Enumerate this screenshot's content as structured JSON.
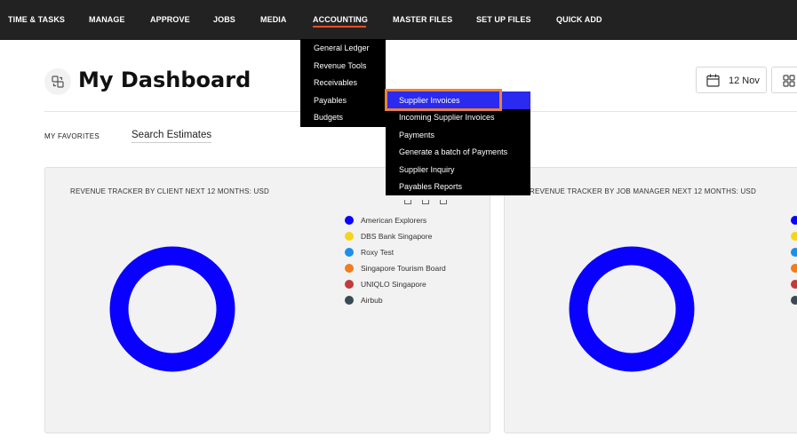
{
  "nav": {
    "items": [
      {
        "label": "TIME & TASKS"
      },
      {
        "label": "MANAGE"
      },
      {
        "label": "APPROVE"
      },
      {
        "label": "JOBS"
      },
      {
        "label": "MEDIA"
      },
      {
        "label": "ACCOUNTING",
        "active": true
      },
      {
        "label": "MASTER FILES"
      },
      {
        "label": "SET UP FILES"
      },
      {
        "label": "QUICK ADD"
      }
    ],
    "accent_color": "#f04e23"
  },
  "accounting_menu": {
    "items": [
      "General Ledger",
      "Revenue Tools",
      "Receivables",
      "Payables",
      "Budgets"
    ]
  },
  "payables_menu": {
    "items": [
      "Supplier Invoices",
      "Incoming Supplier Invoices",
      "Payments",
      "Generate a batch of Payments",
      "Supplier Inquiry",
      "Payables Reports"
    ],
    "highlighted_index": 0,
    "highlight_color": "#2a2af0"
  },
  "header": {
    "title": "My Dashboard",
    "date_label": "12 Nov",
    "dashboard_icon": "dashboard-swap-icon",
    "calendar_icon": "calendar-icon",
    "grid_icon": "grid-icon"
  },
  "favorites": {
    "label": "MY FAVORITES",
    "links": [
      "Search Estimates"
    ]
  },
  "cards": [
    {
      "title": "REVENUE TRACKER BY CLIENT NEXT 12 MONTHS: USD",
      "donut_color": "#0a00ff",
      "legend": [
        {
          "label": "American Explorers",
          "color": "#0a00ff"
        },
        {
          "label": "DBS Bank Singapore",
          "color": "#f5d51c"
        },
        {
          "label": "Roxy Test",
          "color": "#1e8fe6"
        },
        {
          "label": "Singapore Tourism Board",
          "color": "#f07d1f"
        },
        {
          "label": "UNIQLO Singapore",
          "color": "#c23b3b"
        },
        {
          "label": "Airbub",
          "color": "#3a4a55"
        }
      ]
    },
    {
      "title": "REVENUE TRACKER BY JOB MANAGER NEXT 12 MONTHS: USD",
      "donut_color": "#0a00ff",
      "legend_colors": [
        "#0a00ff",
        "#f5d51c",
        "#1e8fe6",
        "#f07d1f",
        "#c23b3b",
        "#3a4a55"
      ]
    }
  ]
}
